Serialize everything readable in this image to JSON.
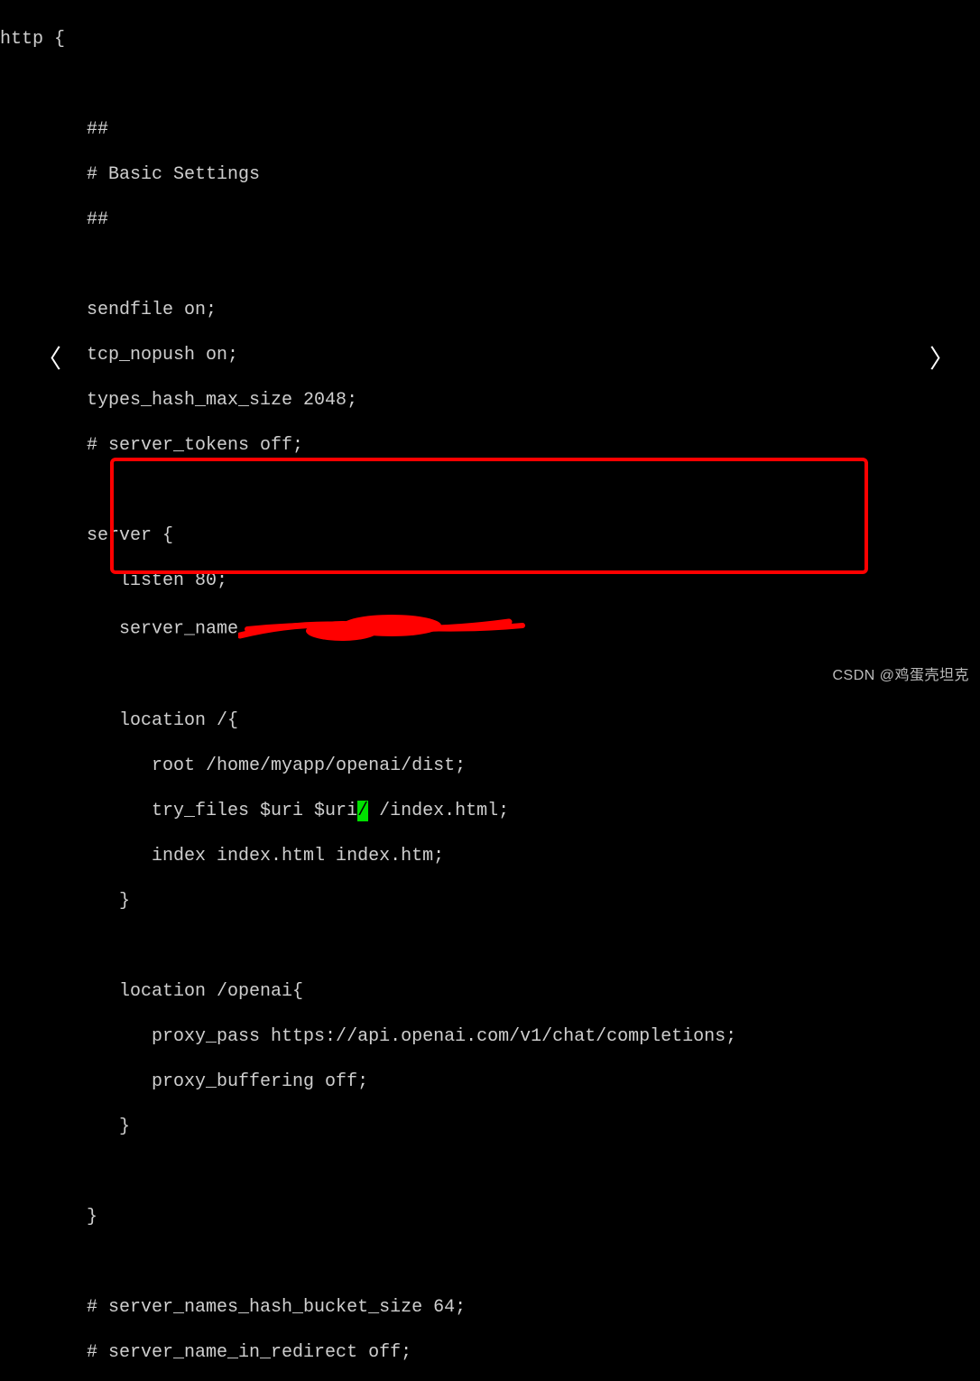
{
  "code": {
    "l01": "http {",
    "l02": "",
    "l03": "        ##",
    "l04": "        # Basic Settings",
    "l05": "        ##",
    "l06": "",
    "l07": "        sendfile on;",
    "l08": "        tcp_nopush on;",
    "l09": "        types_hash_max_size 2048;",
    "l10": "        # server_tokens off;",
    "l11": "",
    "l12": "        server {",
    "l13": "           listen 80;",
    "l14_a": "           server_name",
    "l15": "",
    "l16": "           location /{",
    "l17": "              root /home/myapp/openai/dist;",
    "l18_a": "              try_files $uri $uri",
    "l18_cursor": "/",
    "l18_b": " /index.html;",
    "l19": "              index index.html index.htm;",
    "l20": "           }",
    "l21": "",
    "l22": "           location /openai{",
    "l23": "              proxy_pass https://api.openai.com/v1/chat/completions;",
    "l24": "              proxy_buffering off;",
    "l25": "           }",
    "l26": "",
    "l27": "        }",
    "l28": "",
    "l29": "        # server_names_hash_bucket_size 64;",
    "l30": "        # server_name_in_redirect off;"
  },
  "nav": {
    "prev": "〈",
    "next": "〉"
  },
  "watermark": "CSDN @鸡蛋壳坦克"
}
